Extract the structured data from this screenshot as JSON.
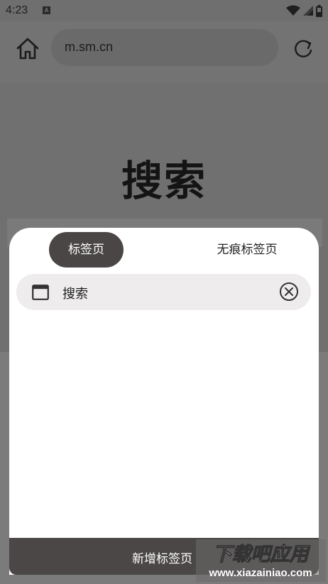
{
  "status_bar": {
    "time": "4:23",
    "notification_icon": "A"
  },
  "toolbar": {
    "url": "m.sm.cn"
  },
  "page": {
    "title": "搜索"
  },
  "tab_switcher": {
    "tabs": [
      {
        "label": "标签页",
        "active": true
      },
      {
        "label": "无痕标签页",
        "active": false
      }
    ],
    "open_tabs": [
      {
        "title": "搜索"
      }
    ],
    "new_tab_label": "新增标签页"
  },
  "watermark": {
    "line1": "下载吧应用",
    "line2": "www.xiazainiao.com"
  },
  "colors": {
    "overlay": "#777777",
    "sheet": "#ffffff",
    "accent_dark": "#4a4646",
    "tab_card": "#eeeced"
  }
}
